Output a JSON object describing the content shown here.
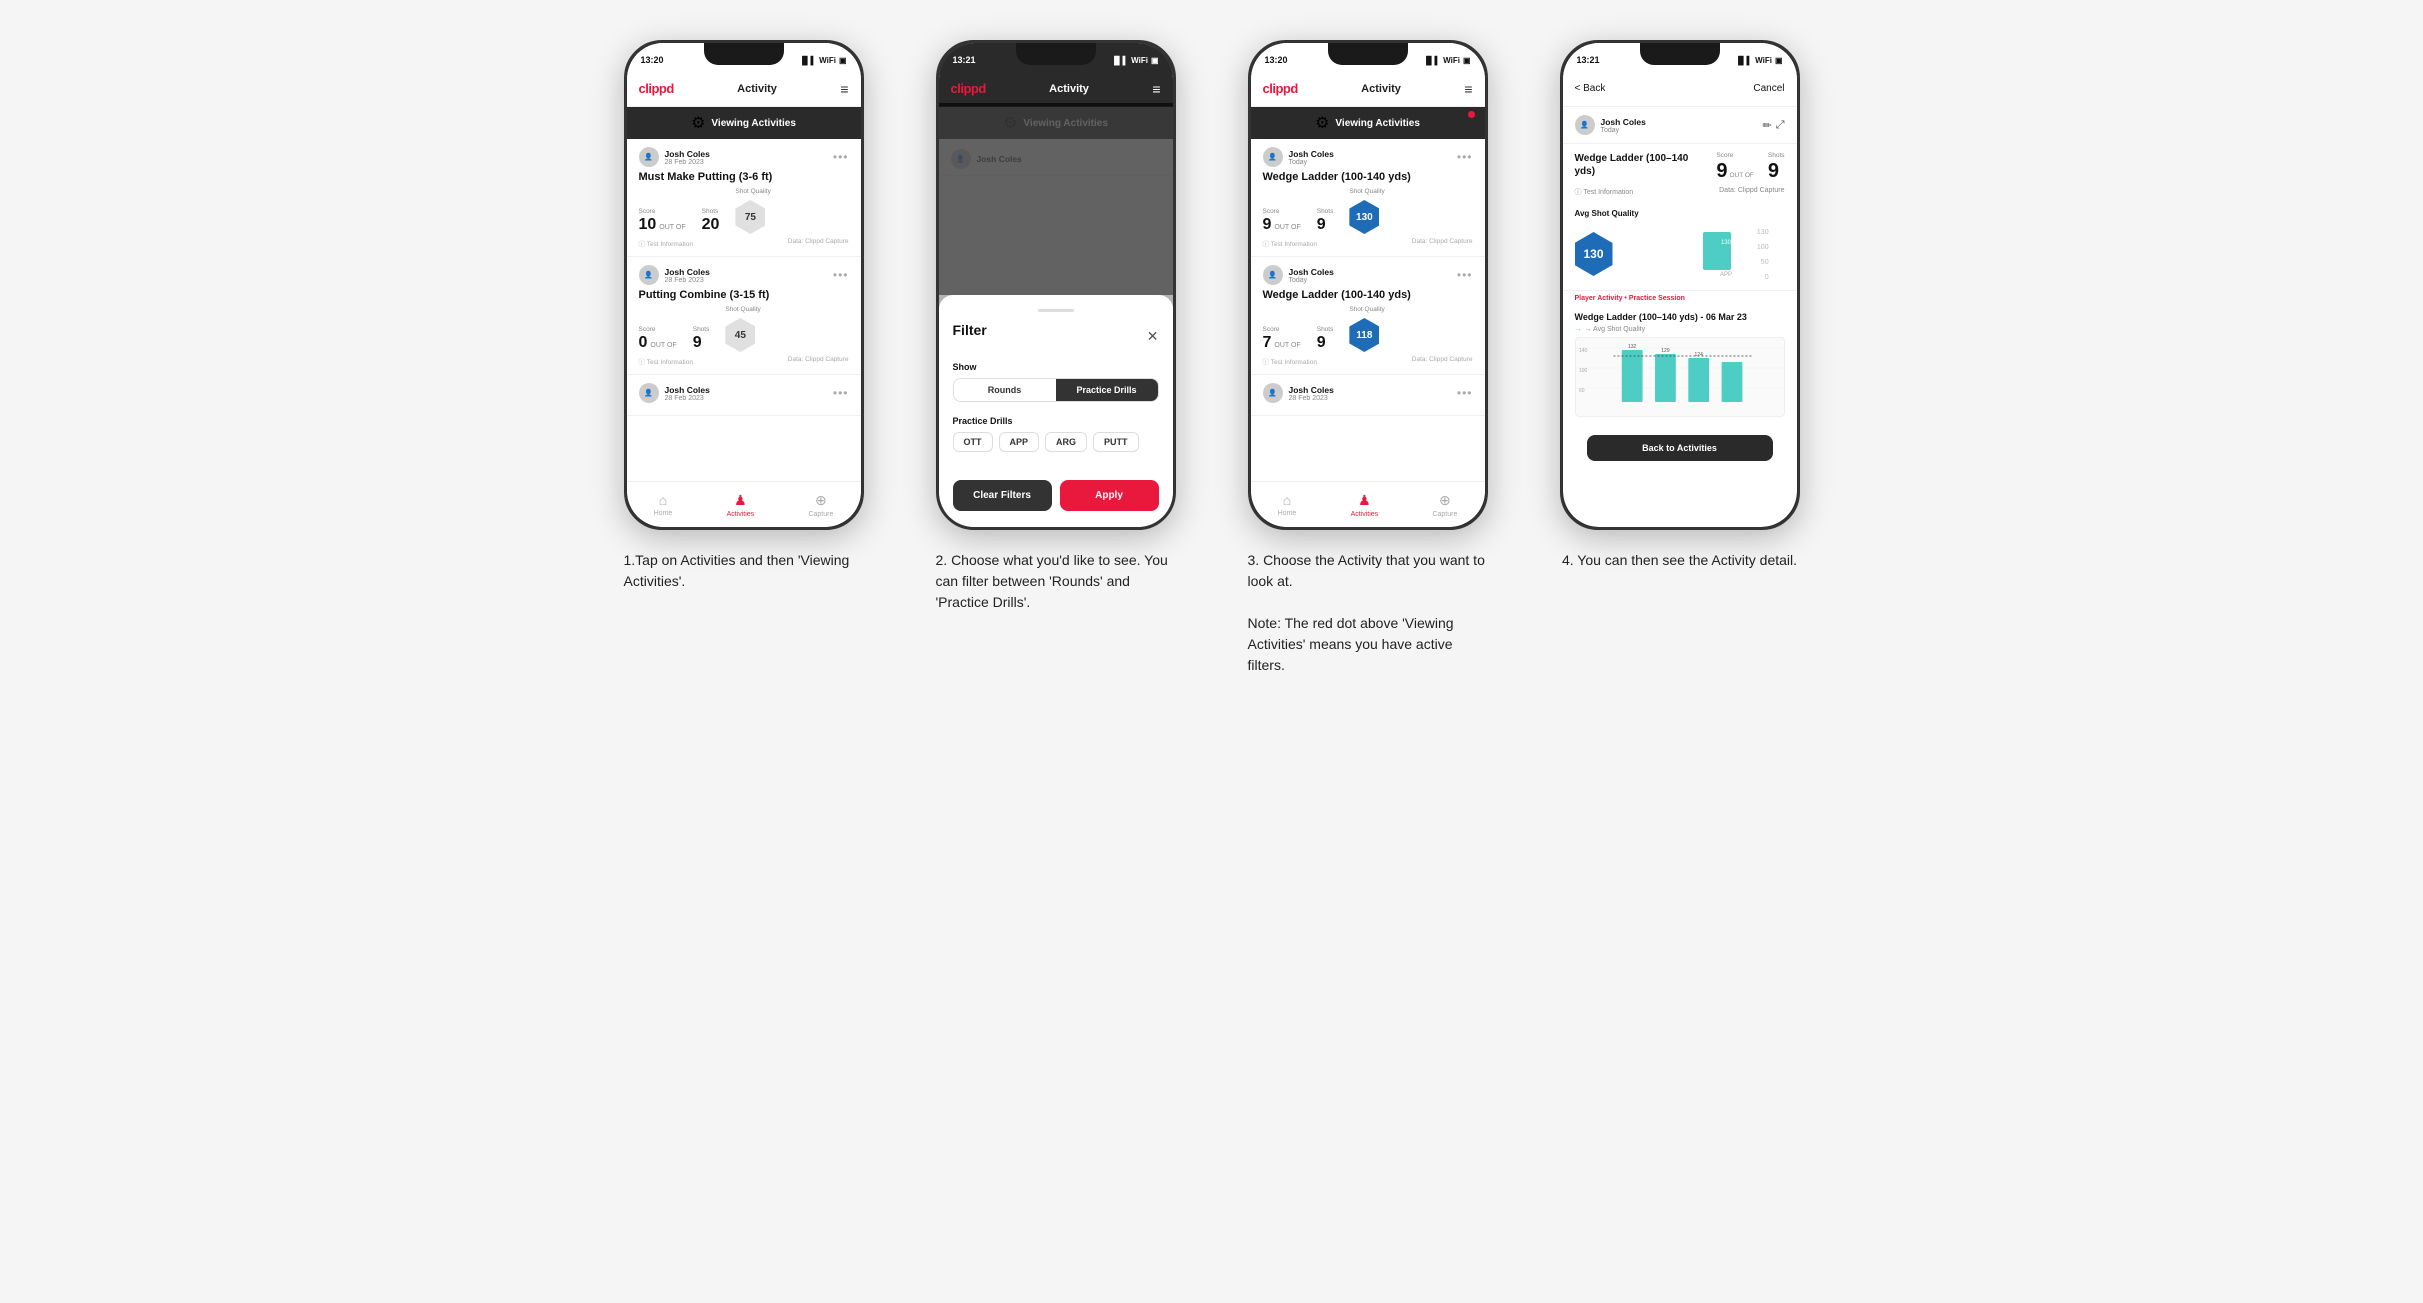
{
  "phones": [
    {
      "id": "phone1",
      "status_time": "13:20",
      "header": {
        "logo": "clippd",
        "title": "Activity",
        "menu": "≡"
      },
      "banner": {
        "text": "Viewing Activities",
        "has_red_dot": false
      },
      "cards": [
        {
          "user_name": "Josh Coles",
          "user_date": "28 Feb 2023",
          "title": "Must Make Putting (3-6 ft)",
          "score_label": "Score",
          "shots_label": "Shots",
          "quality_label": "Shot Quality",
          "score": "10",
          "out_of": "OUT OF",
          "shots": "20",
          "quality": "75",
          "quality_color": "grey",
          "footer_left": "ⓘ Test Information",
          "footer_right": "Data: Clippd Capture"
        },
        {
          "user_name": "Josh Coles",
          "user_date": "28 Feb 2023",
          "title": "Putting Combine (3-15 ft)",
          "score_label": "Score",
          "shots_label": "Shots",
          "quality_label": "Shot Quality",
          "score": "0",
          "out_of": "OUT OF",
          "shots": "9",
          "quality": "45",
          "quality_color": "grey",
          "footer_left": "ⓘ Test Information",
          "footer_right": "Data: Clippd Capture"
        },
        {
          "user_name": "Josh Coles",
          "user_date": "28 Feb 2023",
          "title": "",
          "score": "",
          "shots": "",
          "quality": ""
        }
      ],
      "nav": [
        {
          "label": "Home",
          "icon": "⌂",
          "active": false
        },
        {
          "label": "Activities",
          "icon": "♟",
          "active": true
        },
        {
          "label": "Capture",
          "icon": "⊕",
          "active": false
        }
      ]
    },
    {
      "id": "phone2",
      "status_time": "13:21",
      "header": {
        "logo": "clippd",
        "title": "Activity",
        "menu": "≡"
      },
      "banner": {
        "text": "Viewing Activities",
        "has_red_dot": false
      },
      "josh_partial": "Josh Coles",
      "filter": {
        "title": "Filter",
        "show_label": "Show",
        "toggle_buttons": [
          "Rounds",
          "Practice Drills"
        ],
        "active_toggle": "Practice Drills",
        "practice_drills_label": "Practice Drills",
        "chips": [
          "OTT",
          "APP",
          "ARG",
          "PUTT"
        ],
        "clear_label": "Clear Filters",
        "apply_label": "Apply"
      }
    },
    {
      "id": "phone3",
      "status_time": "13:20",
      "header": {
        "logo": "clippd",
        "title": "Activity",
        "menu": "≡"
      },
      "banner": {
        "text": "Viewing Activities",
        "has_red_dot": true
      },
      "cards": [
        {
          "user_name": "Josh Coles",
          "user_date": "Today",
          "title": "Wedge Ladder (100-140 yds)",
          "score_label": "Score",
          "shots_label": "Shots",
          "quality_label": "Shot Quality",
          "score": "9",
          "out_of": "OUT OF",
          "shots": "9",
          "quality": "130",
          "quality_color": "blue",
          "footer_left": "ⓘ Test Information",
          "footer_right": "Data: Clippd Capture"
        },
        {
          "user_name": "Josh Coles",
          "user_date": "Today",
          "title": "Wedge Ladder (100-140 yds)",
          "score_label": "Score",
          "shots_label": "Shots",
          "quality_label": "Shot Quality",
          "score": "7",
          "out_of": "OUT OF",
          "shots": "9",
          "quality": "118",
          "quality_color": "blue",
          "footer_left": "ⓘ Test Information",
          "footer_right": "Data: Clippd Capture"
        },
        {
          "user_name": "Josh Coles",
          "user_date": "28 Feb 2023",
          "title": "",
          "score": "",
          "shots": "",
          "quality": ""
        }
      ],
      "nav": [
        {
          "label": "Home",
          "icon": "⌂",
          "active": false
        },
        {
          "label": "Activities",
          "icon": "♟",
          "active": true
        },
        {
          "label": "Capture",
          "icon": "⊕",
          "active": false
        }
      ]
    },
    {
      "id": "phone4",
      "status_time": "13:21",
      "back_label": "< Back",
      "cancel_label": "Cancel",
      "user_name": "Josh Coles",
      "user_date": "Today",
      "activity_title": "Wedge Ladder (100–140 yds)",
      "score_label": "Score",
      "shots_label": "Shots",
      "score": "9",
      "out_of": "OUT OF",
      "shots": "9",
      "info_text": "ⓘ Test Information",
      "data_text": "Data: Clippd Capture",
      "avg_title": "Avg Shot Quality",
      "avg_value": "130",
      "chart_value": "130",
      "chart_label": "APP",
      "y_labels": [
        "100",
        "50",
        "0"
      ],
      "player_activity_prefix": "Player Activity •",
      "player_activity_value": "Practice Session",
      "session_title": "Wedge Ladder (100–140 yds) - 06 Mar 23",
      "session_subtitle": "→ Avg Shot Quality",
      "session_bars": [
        {
          "value": 132,
          "label": ""
        },
        {
          "value": 129,
          "label": ""
        },
        {
          "value": 124,
          "label": ""
        },
        {
          "value": 120,
          "label": ""
        }
      ],
      "session_bar_values": [
        "132",
        "129",
        "124",
        ""
      ],
      "back_activities_label": "Back to Activities"
    }
  ],
  "captions": [
    "1.Tap on Activities and then 'Viewing Activities'.",
    "2. Choose what you'd like to see. You can filter between 'Rounds' and 'Practice Drills'.",
    "3. Choose the Activity that you want to look at.\n\nNote: The red dot above 'Viewing Activities' means you have active filters.",
    "4. You can then see the Activity detail."
  ]
}
